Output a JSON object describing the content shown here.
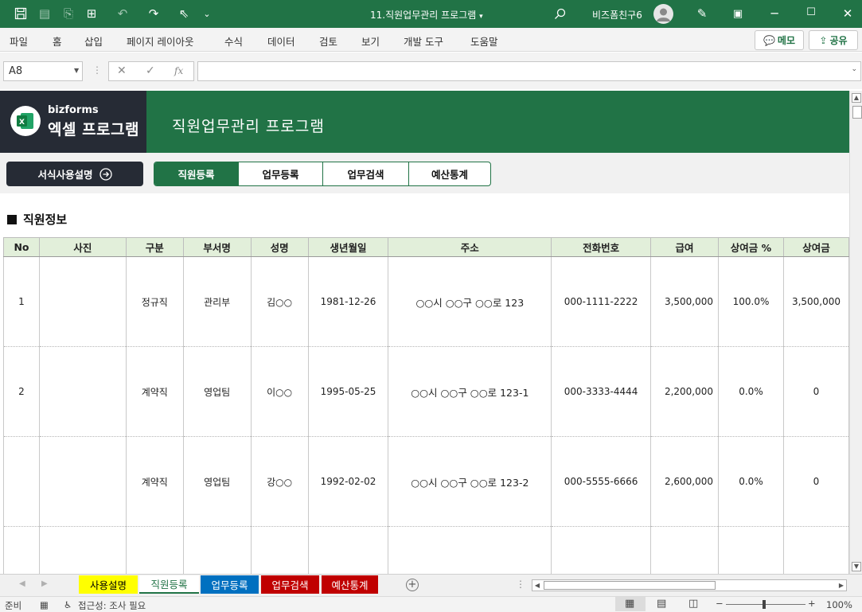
{
  "titlebar": {
    "title": "11.직원업무관리 프로그램",
    "title_dropdown": "▾",
    "user_name": "비즈폼친구6"
  },
  "ribbon": {
    "tabs": [
      "파일",
      "홈",
      "삽입",
      "페이지 레이아웃",
      "수식",
      "데이터",
      "검토",
      "보기",
      "개발 도구",
      "도움말"
    ],
    "memo_label": "메모",
    "share_label": "공유"
  },
  "formula_bar": {
    "cell_ref": "A8",
    "fx_label": "fx",
    "formula": ""
  },
  "banner": {
    "brand_small": "bizforms",
    "brand_big": "엑셀 프로그램",
    "title": "직원업무관리 프로그램"
  },
  "nav": {
    "guide_label": "서식사용설명",
    "tabs": [
      "직원등록",
      "업무등록",
      "업무검색",
      "예산통계"
    ],
    "active_tab": "직원등록"
  },
  "section": {
    "title": "직원정보"
  },
  "table": {
    "headers": [
      "No",
      "사진",
      "구분",
      "부서명",
      "성명",
      "생년월일",
      "주소",
      "전화번호",
      "급여",
      "상여금 %",
      "상여금"
    ],
    "rows": [
      [
        "1",
        "",
        "정규직",
        "관리부",
        "김○○",
        "1981-12-26",
        "○○시 ○○구 ○○로 123",
        "000-1111-2222",
        "3,500,000",
        "100.0%",
        "3,500,000"
      ],
      [
        "2",
        "",
        "계약직",
        "영업팀",
        "이○○",
        "1995-05-25",
        "○○시 ○○구 ○○로 123-1",
        "000-3333-4444",
        "2,200,000",
        "0.0%",
        "0"
      ],
      [
        "",
        "",
        "계약직",
        "영업팀",
        "강○○",
        "1992-02-02",
        "○○시 ○○구 ○○로 123-2",
        "000-5555-6666",
        "2,600,000",
        "0.0%",
        "0"
      ]
    ]
  },
  "sheet_tabs": [
    {
      "label": "사용설명",
      "bg": "#ffff00",
      "color": "#000000"
    },
    {
      "label": "직원등록",
      "bg": "#ffffff",
      "color": "#217346"
    },
    {
      "label": "업무등록",
      "bg": "#0070c0",
      "color": "#ffffff"
    },
    {
      "label": "업무검색",
      "bg": "#c00000",
      "color": "#ffffff"
    },
    {
      "label": "예산통계",
      "bg": "#c00000",
      "color": "#ffffff"
    }
  ],
  "statusbar": {
    "ready": "준비",
    "accessibility": "접근성: 조사 필요",
    "zoom": "100%"
  },
  "colors": {
    "excel_green": "#217346",
    "dark_navy": "#262b35",
    "header_fill": "#e2efda"
  }
}
